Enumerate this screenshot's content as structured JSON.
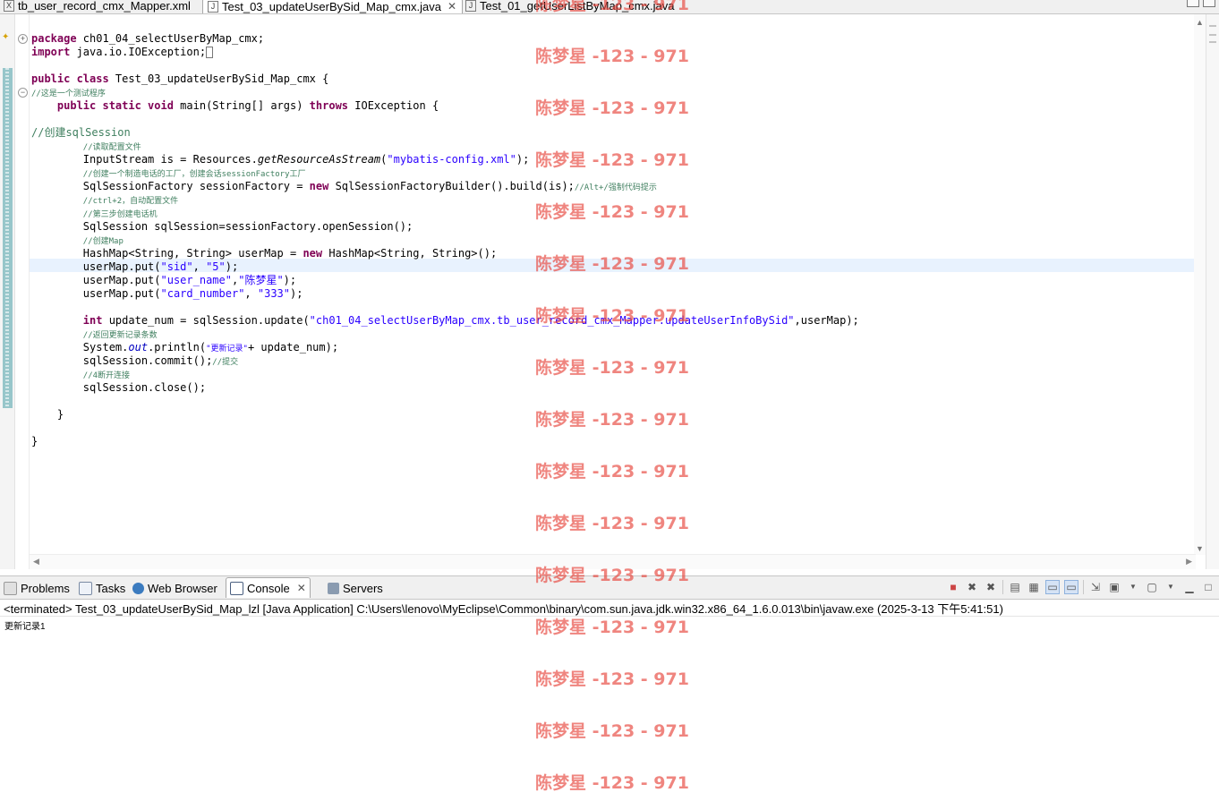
{
  "editor_tabs": [
    {
      "icon": "xml-file-icon",
      "label": "tb_user_record_cmx_Mapper.xml",
      "active": false
    },
    {
      "icon": "java-file-icon",
      "label": "Test_03_updateUserBySid_Map_cmx.java",
      "active": true,
      "close": "✕"
    },
    {
      "icon": "java-file-icon",
      "label": "Test_01_getUserListByMap_cmx.java",
      "active": false
    }
  ],
  "code": {
    "l1_kw": "package",
    "l1_rest": " ch01_04_selectUserByMap_cmx;",
    "l2_kw": "import",
    "l2_rest": " java.io.IOException;",
    "l4_kw": "public class",
    "l4_rest": " Test_03_updateUserBySid_Map_cmx {",
    "l5_cmt": "//这是一个测试程序",
    "l6_kw1": "public static void",
    "l6_mid": " main(String[] args) ",
    "l6_kw2": "throws",
    "l6_rest": " IOException {",
    "l8_cmt": "//创建sqlSession",
    "l9_cmt": "//读取配置文件",
    "l10_a": "InputStream is = Resources.",
    "l10_method": "getResourceAsStream",
    "l10_b": "(",
    "l10_str": "\"mybatis-config.xml\"",
    "l10_c": ");",
    "l11_cmt": "//创建一个制造电话的工厂，创建会话sessionFactory工厂",
    "l12_a": "SqlSessionFactory sessionFactory = ",
    "l12_kw": "new",
    "l12_b": " SqlSessionFactoryBuilder().build(is);",
    "l12_cmt": "//Alt+/强制代码提示",
    "l13_cmt": "//ctrl+2，自动配置文件",
    "l14_cmt": "//第三步创建电话机",
    "l15": "SqlSession sqlSession=sessionFactory.openSession();",
    "l16_cmt": "//创建Map",
    "l17_a": "HashMap<String, String> userMap = ",
    "l17_kw": "new",
    "l17_b": " HashMap<String, String>();",
    "l18_a": "userMap.put(",
    "l18_s1": "\"sid\"",
    "l18_b": ", ",
    "l18_s2": "\"5\"",
    "l18_c": ");",
    "l19_a": "userMap.put(",
    "l19_s1": "\"user_name\"",
    "l19_b": ",",
    "l19_s2": "\"陈梦星\"",
    "l19_c": ");",
    "l20_a": "userMap.put(",
    "l20_s1": "\"card_number\"",
    "l20_b": ", ",
    "l20_s2": "\"333\"",
    "l20_c": ");",
    "l22_kw": "int",
    "l22_a": " update_num = sqlSession.update(",
    "l22_str": "\"ch01_04_selectUserByMap_cmx.tb_user_record_cmx_Mapper.updateUserInfoBySid\"",
    "l22_b": ",userMap);",
    "l23_cmt": "//返回更新记录条数",
    "l24_a": "System.",
    "l24_field": "out",
    "l24_b": ".println(",
    "l24_str": "\"更新记录\"",
    "l24_c": "+ update_num);",
    "l25_a": "sqlSession.commit();",
    "l25_cmt": "//提交",
    "l26_cmt": "//4断开连接",
    "l27": "sqlSession.close();",
    "l29": "}",
    "l31": "}"
  },
  "views": {
    "tabs": [
      {
        "label": "Problems",
        "icon": "problems-icon"
      },
      {
        "label": "Tasks",
        "icon": "tasks-icon"
      },
      {
        "label": "Web Browser",
        "icon": "globe-icon"
      },
      {
        "label": "Console",
        "icon": "console-icon",
        "active": true
      },
      {
        "label": "Servers",
        "icon": "servers-icon"
      }
    ]
  },
  "console": {
    "header": "<terminated> Test_03_updateUserBySid_Map_lzl [Java Application] C:\\Users\\lenovo\\MyEclipse\\Common\\binary\\com.sun.java.jdk.win32.x86_64_1.6.0.013\\bin\\javaw.exe (2025-3-13 下午5:41:51)",
    "output": "更新记录1"
  },
  "watermark": {
    "text": "陈梦星 -123 - 971",
    "color": "#e8443b"
  }
}
